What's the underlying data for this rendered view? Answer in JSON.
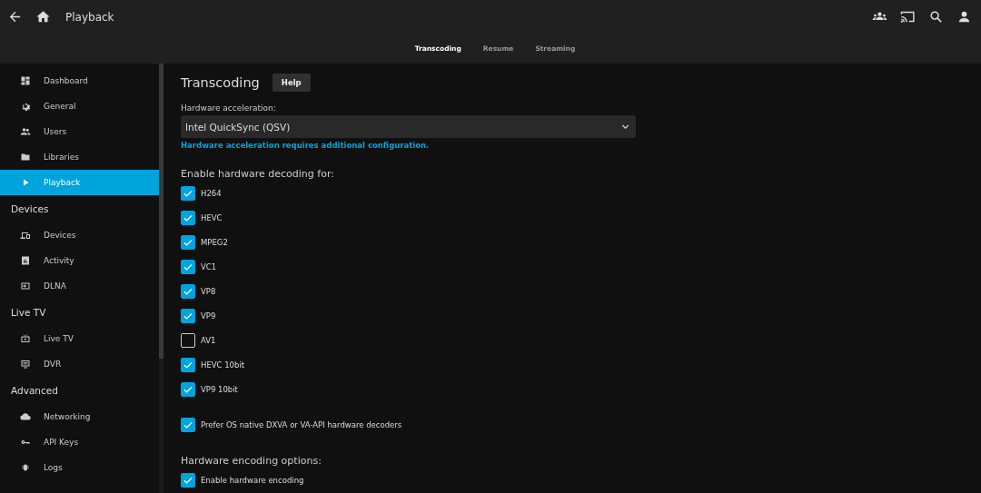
{
  "header": {
    "title": "Playback"
  },
  "tabs": [
    {
      "label": "Transcoding",
      "selected": true
    },
    {
      "label": "Resume",
      "selected": false
    },
    {
      "label": "Streaming",
      "selected": false
    }
  ],
  "sidebar": {
    "items": [
      {
        "kind": "item",
        "label": "Dashboard",
        "selected": false
      },
      {
        "kind": "item",
        "label": "General",
        "selected": false
      },
      {
        "kind": "item",
        "label": "Users",
        "selected": false
      },
      {
        "kind": "item",
        "label": "Libraries",
        "selected": false
      },
      {
        "kind": "item",
        "label": "Playback",
        "selected": true
      },
      {
        "kind": "heading",
        "label": "Devices"
      },
      {
        "kind": "item",
        "label": "Devices",
        "selected": false
      },
      {
        "kind": "item",
        "label": "Activity",
        "selected": false
      },
      {
        "kind": "item",
        "label": "DLNA",
        "selected": false
      },
      {
        "kind": "heading",
        "label": "Live TV"
      },
      {
        "kind": "item",
        "label": "Live TV",
        "selected": false
      },
      {
        "kind": "item",
        "label": "DVR",
        "selected": false
      },
      {
        "kind": "heading",
        "label": "Advanced"
      },
      {
        "kind": "item",
        "label": "Networking",
        "selected": false
      },
      {
        "kind": "item",
        "label": "API Keys",
        "selected": false
      },
      {
        "kind": "item",
        "label": "Logs",
        "selected": false
      }
    ]
  },
  "content": {
    "title": "Transcoding",
    "help_button": "Help",
    "hardware_acceleration": {
      "label": "Hardware acceleration:",
      "value": "Intel QuickSync (QSV)",
      "note": "Hardware acceleration requires additional configuration."
    },
    "decoding_heading": "Enable hardware decoding for:",
    "decoding": [
      {
        "label": "H264",
        "checked": true
      },
      {
        "label": "HEVC",
        "checked": true
      },
      {
        "label": "MPEG2",
        "checked": true
      },
      {
        "label": "VC1",
        "checked": true
      },
      {
        "label": "VP8",
        "checked": true
      },
      {
        "label": "VP9",
        "checked": true
      },
      {
        "label": "AV1",
        "checked": false
      },
      {
        "label": "HEVC 10bit",
        "checked": true
      },
      {
        "label": "VP9 10bit",
        "checked": true
      }
    ],
    "prefer_native": {
      "label": "Prefer OS native DXVA or VA-API hardware decoders",
      "checked": true
    },
    "encoding_heading": "Hardware encoding options:",
    "encoding": [
      {
        "label": "Enable hardware encoding",
        "checked": true
      }
    ]
  }
}
